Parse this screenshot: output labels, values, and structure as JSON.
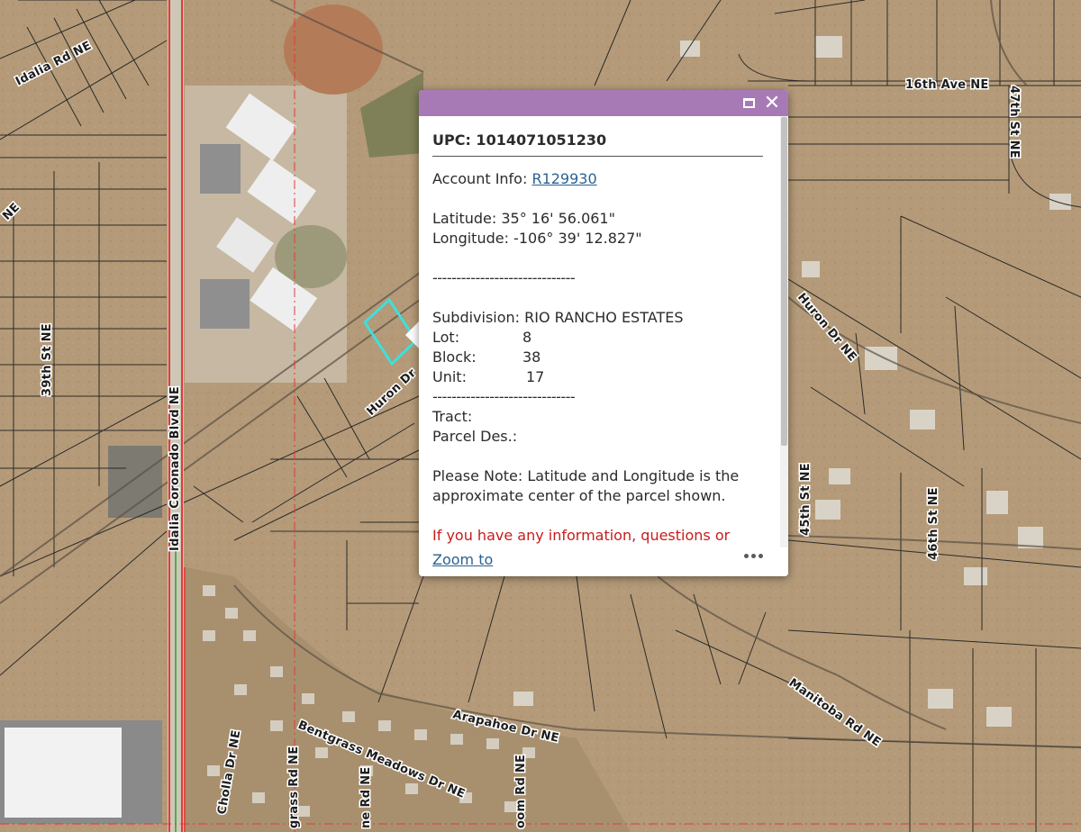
{
  "map": {
    "roads": [
      {
        "name": "idalia-rd-label",
        "text": "Idalia Rd NE"
      },
      {
        "name": "16th-ave-label",
        "text": "16th Ave NE"
      },
      {
        "name": "47th-st-label",
        "text": "47th St NE"
      },
      {
        "name": "ne-left-label",
        "text": "NE"
      },
      {
        "name": "39th-st-label",
        "text": "39th St NE"
      },
      {
        "name": "huron-dr-label",
        "text": "Huron Dr"
      },
      {
        "name": "huron-dr-ne-label",
        "text": "Huron Dr NE"
      },
      {
        "name": "45th-st-label",
        "text": "45th St NE"
      },
      {
        "name": "46th-st-label",
        "text": "46th St NE"
      },
      {
        "name": "coronado-blvd-label",
        "text": "Idalia Coronado Blvd NE"
      },
      {
        "name": "manitoba-rd-label",
        "text": "Manitoba Rd NE"
      },
      {
        "name": "arapahoe-dr-label",
        "text": "Arapahoe Dr NE"
      },
      {
        "name": "bentgrass-label",
        "text": "Bentgrass Meadows Dr NE"
      },
      {
        "name": "cholla-dr-label",
        "text": "Cholla Dr NE"
      },
      {
        "name": "grass-rd-label",
        "text": "grass Rd NE"
      },
      {
        "name": "ne-rd-label",
        "text": "ne Rd NE"
      },
      {
        "name": "bloom-rd-label",
        "text": "oom Rd NE"
      }
    ],
    "colors": {
      "terrain": "#b49a78",
      "parcel_line": "#2a2a2a",
      "highway": "#e23a3a",
      "selection": "#3ee0dc"
    }
  },
  "popup": {
    "header_color": "#a77ab6",
    "icons": {
      "maximize": "maximize-icon",
      "close": "close-icon"
    },
    "upc": "UPC: 1014071051230",
    "account_label": "Account Info: ",
    "account_link": "R129930",
    "latitude": "Latitude: 35° 16' 56.061\"",
    "longitude": "Longitude: -106° 39' 12.827\"",
    "separator": "------------------------------",
    "subdivision": "Subdivision: RIO RANCHO ESTATES",
    "lot_label": "Lot:",
    "lot_value": "8",
    "block_label": "Block:",
    "block_value": "38",
    "unit_label": "Unit:",
    "unit_value": "17",
    "tract": "Tract:",
    "parcel_des": "Parcel Des.:",
    "note": "Please Note: Latitude and Longitude is the approximate center of the parcel shown.",
    "contact": "If you have any information, questions or concerns about this parcel please contact",
    "zoom_to": "Zoom to",
    "more_icon": "more-options-icon"
  }
}
